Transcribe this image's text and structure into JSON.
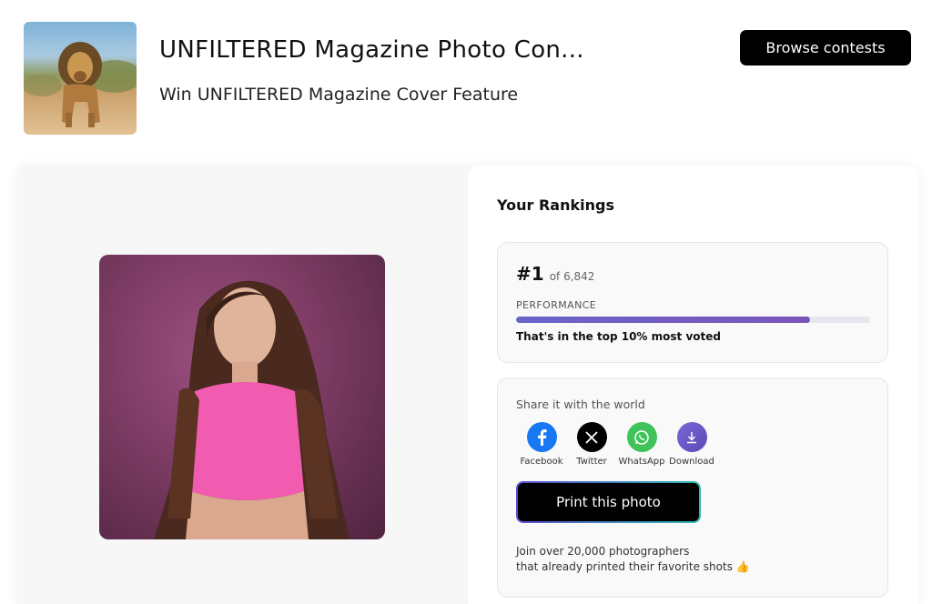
{
  "contest": {
    "title": "UNFILTERED Magazine Photo Con...",
    "subtitle": "Win UNFILTERED Magazine Cover Feature",
    "browse_label": "Browse contests"
  },
  "rankings": {
    "heading": "Your Rankings",
    "rank": "#1",
    "of_total": "of 6,842",
    "performance_label": "PERFORMANCE",
    "performance_fraction": 0.83,
    "performance_text": "That's in the top 10% most voted"
  },
  "share": {
    "title": "Share it with the world",
    "items": [
      {
        "label": "Facebook",
        "icon": "facebook-icon",
        "color": "#1877f2"
      },
      {
        "label": "Twitter",
        "icon": "x-icon",
        "color": "#000000"
      },
      {
        "label": "WhatsApp",
        "icon": "whatsapp-icon",
        "color": "#3fc35a"
      },
      {
        "label": "Download",
        "icon": "download-icon",
        "color": "#6a57c8"
      }
    ],
    "print_label": "Print this photo",
    "join_line1": "Join over 20,000 photographers",
    "join_line2": "that already printed their favorite shots 👍"
  },
  "colors": {
    "accent_start": "#6a64c9",
    "accent_end": "#7a55b8",
    "button_bg": "#000000"
  }
}
